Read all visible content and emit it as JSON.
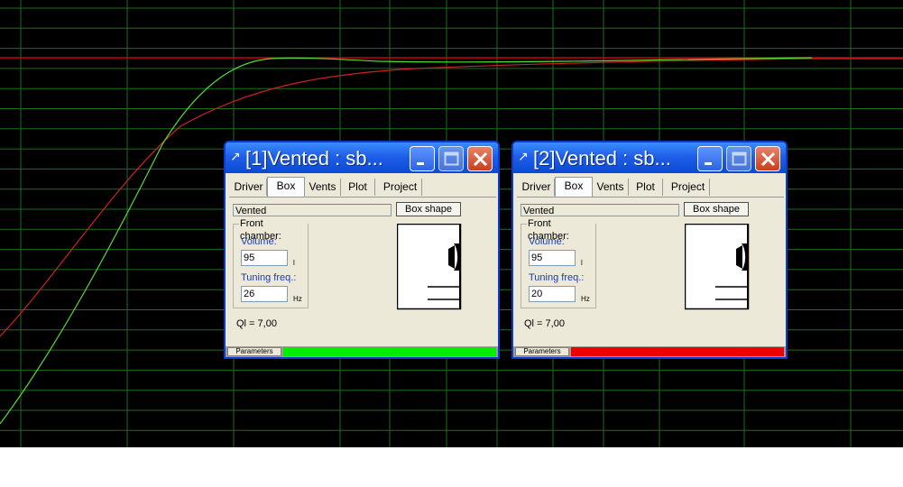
{
  "plot": {
    "background": "#000000",
    "grid_color": "#1e6e1e",
    "reference_color": "#cc0000",
    "curve1_color": "#55dd33",
    "curve2_color": "#cc2222"
  },
  "windows": [
    {
      "title": "[1]Vented : sb...",
      "tabs": [
        "Driver",
        "Box",
        "Vents",
        "Plot",
        "Project"
      ],
      "active_tab": "Box",
      "box_type": "Vented",
      "box_shape_button": "Box shape",
      "group_label": "Front chamber:",
      "volume_label": "Volume:",
      "volume_value": "95",
      "volume_unit": "l",
      "tuning_label": "Tuning freq.:",
      "tuning_value": "26",
      "tuning_unit": "Hz",
      "ql_text": "Ql = 7,00",
      "status_label": "Parameters",
      "status_color": "#00ee00"
    },
    {
      "title": "[2]Vented : sb...",
      "tabs": [
        "Driver",
        "Box",
        "Vents",
        "Plot",
        "Project"
      ],
      "active_tab": "Box",
      "box_type": "Vented",
      "box_shape_button": "Box shape",
      "group_label": "Front chamber:",
      "volume_label": "Volume:",
      "volume_value": "95",
      "volume_unit": "l",
      "tuning_label": "Tuning freq.:",
      "tuning_value": "20",
      "tuning_unit": "Hz",
      "ql_text": "Ql = 7,00",
      "status_label": "Parameters",
      "status_color": "#ee0000"
    }
  ]
}
